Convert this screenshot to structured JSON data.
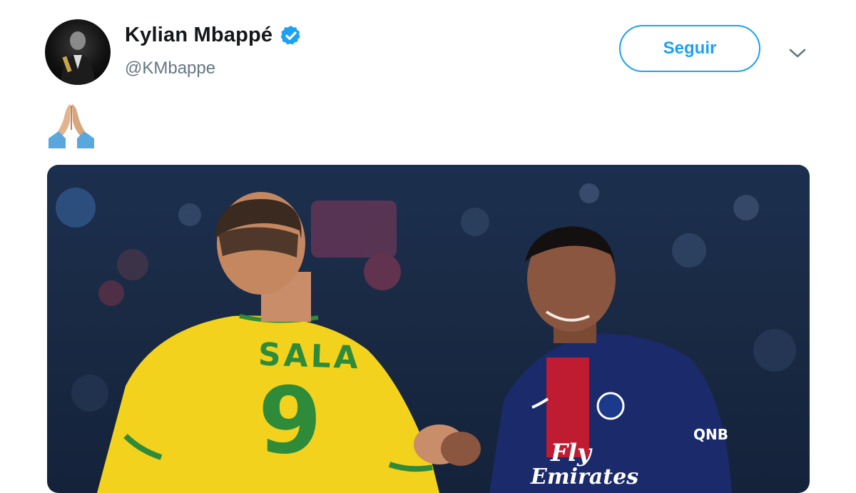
{
  "tweet": {
    "author": {
      "display_name": "Kylian Mbappé",
      "handle": "@KMbappe",
      "verified": true,
      "avatar_icon": "avatar-photo"
    },
    "follow_label": "Seguir",
    "menu_icon": "chevron-down-icon",
    "text_icon": "folded-hands-emoji",
    "colors": {
      "accent": "#1da1f2",
      "name": "#14171a",
      "handle": "#657786"
    }
  },
  "media": {
    "jersey_left": {
      "name": "SALA",
      "number": "9"
    },
    "jersey_right": {
      "sponsor_line1": "Fly",
      "sponsor_line2": "Emirates",
      "sleeve": "QNB"
    }
  }
}
